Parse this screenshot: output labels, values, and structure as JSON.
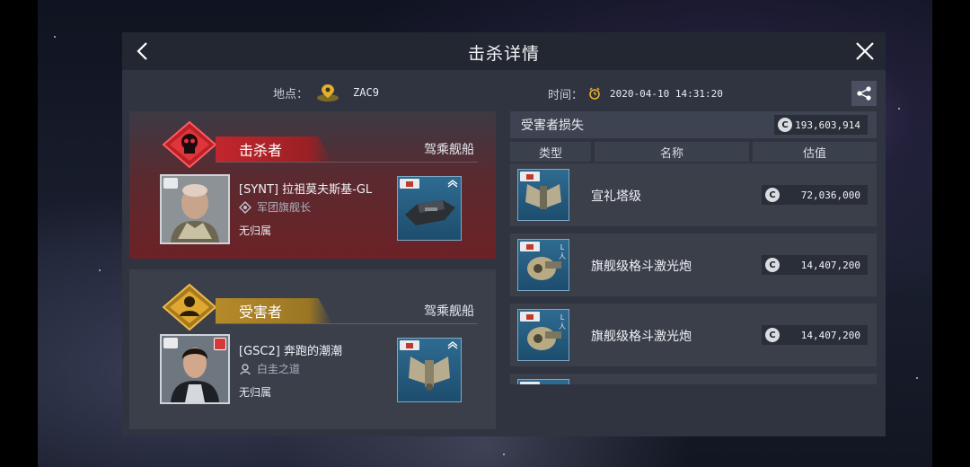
{
  "header": {
    "title": "击杀详情"
  },
  "location": {
    "label": "地点：",
    "value": "ZAC9"
  },
  "time": {
    "label": "时间：",
    "value": "2020-04-10 14:31:20"
  },
  "attacker": {
    "role": "击杀者",
    "ship_label": "驾乘舰船",
    "pilot": "[SYNT] 拉祖莫夫斯基-GL",
    "corp_title": "军团旗舰长",
    "alliance": "无归属",
    "ship_tier": "I"
  },
  "victim": {
    "role": "受害者",
    "ship_label": "驾乘舰船",
    "pilot": "[GSC2] 奔跑的潮潮",
    "corp_title": "白圭之道",
    "alliance": "无归属",
    "ship_tier": "I"
  },
  "loss": {
    "header": "受害者损失",
    "total": "193,603,914",
    "currency_symbol": "C",
    "columns": [
      "类型",
      "名称",
      "估值"
    ],
    "items": [
      {
        "name": "宣礼塔级",
        "value": "72,036,000",
        "tier": "I"
      },
      {
        "name": "旗舰级格斗激光炮",
        "value": "14,407,200",
        "tier": "II"
      },
      {
        "name": "旗舰级格斗激光炮",
        "value": "14,407,200",
        "tier": "II"
      }
    ]
  },
  "colors": {
    "attacker_accent": "#c2262c",
    "victim_accent": "#d8a02c",
    "panel_bg": "#2f3440"
  }
}
